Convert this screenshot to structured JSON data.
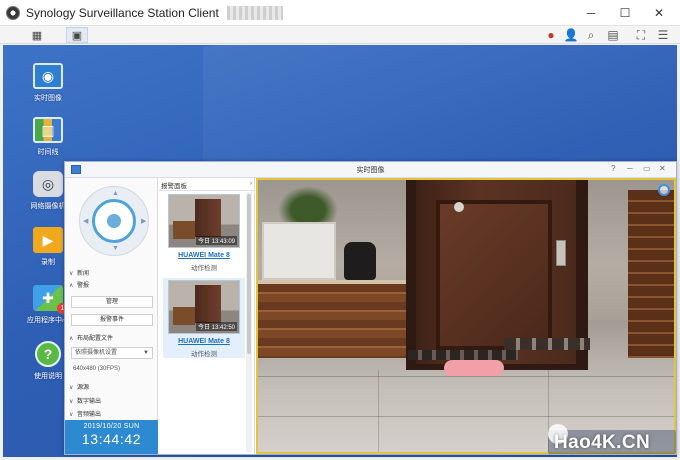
{
  "app": {
    "title": "Synology Surveillance Station Client",
    "colors": {
      "accent": "#2d8ad0",
      "desktop": "#3d73c7",
      "video_border": "#e3c53d",
      "link": "#1f6fb8"
    }
  },
  "desktop_icons": [
    {
      "id": "live-view",
      "label": "实时图像",
      "icon": "camera-monitor-icon"
    },
    {
      "id": "timeline",
      "label": "时间线",
      "icon": "timeline-icon"
    },
    {
      "id": "ip-camera",
      "label": "网络摄像机",
      "icon": "webcam-icon"
    },
    {
      "id": "recording",
      "label": "录制",
      "icon": "film-folder-icon"
    },
    {
      "id": "app-center",
      "label": "应用程序中心",
      "icon": "puzzle-icon",
      "badge": "1"
    },
    {
      "id": "help",
      "label": "使用说明",
      "icon": "help-icon"
    }
  ],
  "live_window": {
    "title": "实时图像",
    "left_panel": {
      "sections": {
        "new": "新闻",
        "alert": "警报",
        "config": "布局配置文件",
        "source": "源源",
        "digital_out": "数字输出",
        "audio_out": "音频输出"
      },
      "buttons": {
        "manage": "管理",
        "alert_search": "报警事件"
      },
      "camera_select": "依照摄像机设置",
      "resolution": "640x480 (30FPS)",
      "clock": {
        "date": "2019/10/20 SUN",
        "time": "13:44:42"
      }
    },
    "alert_panel": {
      "title": "报警面板",
      "items": [
        {
          "timestamp": "今日 13:43:09",
          "camera": "HUAWEI Mate 8",
          "type": "动作检测"
        },
        {
          "timestamp": "今日 13:42:50",
          "camera": "HUAWEI Mate 8",
          "type": "动作检测"
        }
      ]
    }
  },
  "watermark": "Hao4K.CN"
}
